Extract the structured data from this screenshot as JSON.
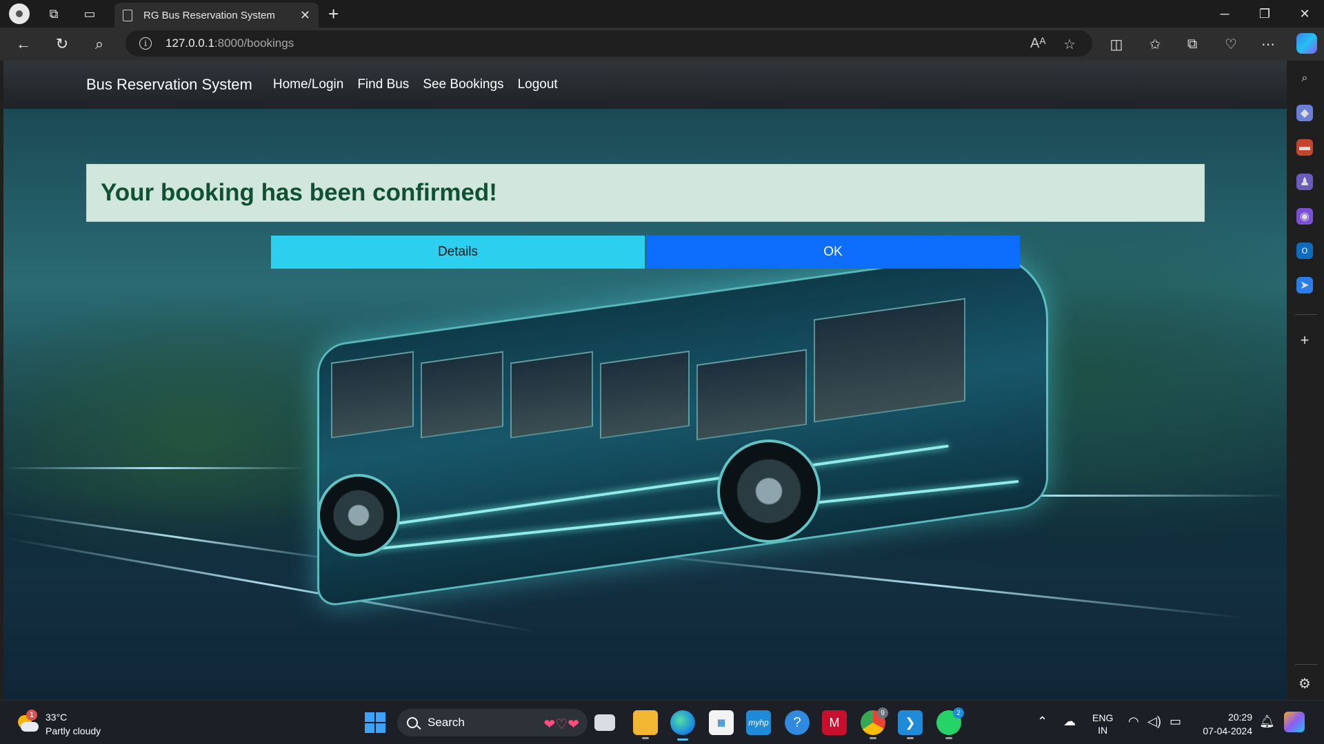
{
  "browser": {
    "tab_title": "RG Bus Reservation System",
    "url_host": "127.0.0.1",
    "url_path": ":8000/bookings"
  },
  "app": {
    "brand": "Bus Reservation System",
    "nav": [
      "Home/Login",
      "Find Bus",
      "See Bookings",
      "Logout"
    ],
    "alert": "Your booking has been confirmed!",
    "details_button": "Details",
    "ok_button": "OK"
  },
  "taskbar": {
    "weather_badge": "1",
    "temperature": "33°C",
    "condition": "Partly cloudy",
    "search_label": "Search",
    "lang_top": "ENG",
    "lang_bottom": "IN",
    "time": "20:29",
    "date": "07-04-2024",
    "chrome_badge": "9",
    "whatsapp_badge": "2",
    "myhp_label": "myhp"
  },
  "colors": {
    "alert_bg": "#d1e7dd",
    "alert_text": "#0f5132",
    "details_bg": "#2ccfee",
    "ok_bg": "#0d6efd"
  }
}
